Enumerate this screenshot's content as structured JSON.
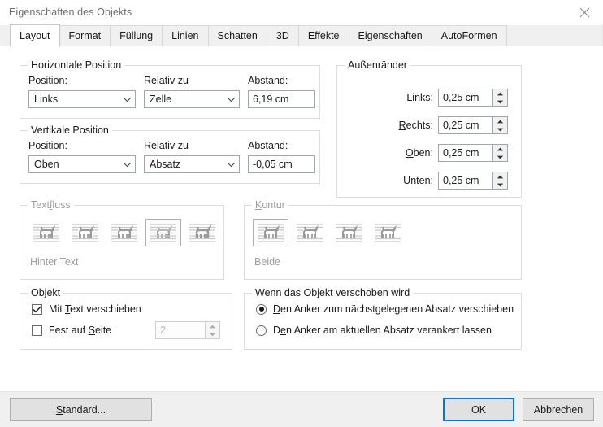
{
  "window": {
    "title": "Eigenschaften des Objekts",
    "close_icon": "close-icon"
  },
  "tabs": [
    {
      "label": "Layout",
      "active": true
    },
    {
      "label": "Format",
      "active": false
    },
    {
      "label": "Füllung",
      "active": false
    },
    {
      "label": "Linien",
      "active": false
    },
    {
      "label": "Schatten",
      "active": false
    },
    {
      "label": "3D",
      "active": false
    },
    {
      "label": "Effekte",
      "active": false
    },
    {
      "label": "Eigenschaften",
      "active": false
    },
    {
      "label": "AutoFormen",
      "active": false
    }
  ],
  "horizontal_position": {
    "legend": "Horizontale Position",
    "position_label": "Position:",
    "position_value": "Links",
    "relative_label": "Relativ zu",
    "relative_value": "Zelle",
    "distance_label": "Abstand:",
    "distance_value": "6,19 cm"
  },
  "vertical_position": {
    "legend": "Vertikale Position",
    "position_label": "Position:",
    "position_value": "Oben",
    "relative_label": "Relativ zu",
    "relative_value": "Absatz",
    "distance_label": "Abstand:",
    "distance_value": "-0,05 cm"
  },
  "margins": {
    "legend": "Außenränder",
    "fields": [
      {
        "label": "Links:",
        "value": "0,25 cm"
      },
      {
        "label": "Rechts:",
        "value": "0,25 cm"
      },
      {
        "label": "Oben:",
        "value": "0,25 cm"
      },
      {
        "label": "Unten:",
        "value": "0,25 cm"
      }
    ]
  },
  "textflow": {
    "legend": "Textfluss",
    "selected_index": 3,
    "selected_label": "Hinter Text",
    "options": [
      "wrap-none-icon",
      "wrap-square-icon",
      "wrap-tight-icon",
      "wrap-behind-text-icon",
      "wrap-in-front-icon"
    ]
  },
  "contour": {
    "legend": "Kontur",
    "selected_index": 0,
    "selected_label": "Beide",
    "options": [
      "contour-both-icon",
      "contour-left-icon",
      "contour-right-icon",
      "contour-largest-icon"
    ]
  },
  "object": {
    "legend": "Objekt",
    "move_with_text_label": "Mit Text verschieben",
    "move_with_text_checked": true,
    "lock_to_page_label": "Fest auf Seite",
    "lock_to_page_checked": false,
    "page_number_value": "2",
    "page_number_disabled": true
  },
  "anchor": {
    "legend": "Wenn das Objekt verschoben wird",
    "options": [
      {
        "label": "Den Anker zum nächstgelegenen Absatz verschieben",
        "selected": true
      },
      {
        "label": "Den Anker am aktuellen Absatz verankert lassen",
        "selected": false
      }
    ]
  },
  "footer": {
    "standard_label": "Standard...",
    "ok_label": "OK",
    "cancel_label": "Abbrechen"
  },
  "colors": {
    "accent": "#0078d7",
    "field_border": "#a0a6b0",
    "group_border": "#dcdcdc",
    "disabled_text": "#9d9d9d",
    "dialog_bg": "#ffffff",
    "footer_bg": "#f0f0f0"
  }
}
